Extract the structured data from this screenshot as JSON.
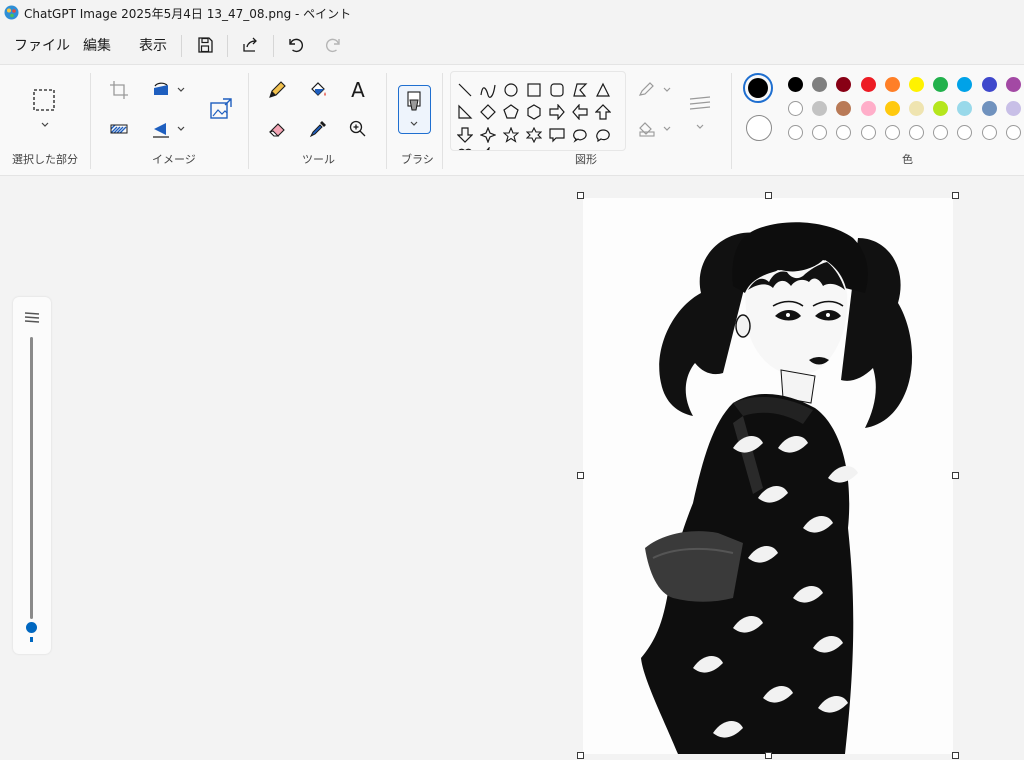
{
  "window": {
    "title": "ChatGPT Image 2025年5月4日 13_47_08.png - ペイント"
  },
  "menu": {
    "file": "ファイル",
    "edit": "編集",
    "view": "表示"
  },
  "ribbon": {
    "selection_label": "選択した部分",
    "image_label": "イメージ",
    "tools_label": "ツール",
    "brush_label": "ブラシ",
    "shapes_label": "図形",
    "colors_label": "色"
  },
  "tools": {
    "text_glyph": "A"
  },
  "palette": {
    "primary": "#000000",
    "secondary": "#ffffff",
    "row1": [
      "#000000",
      "#7f7f7f",
      "#880015",
      "#ed1c24",
      "#ff7f27",
      "#fff200",
      "#22b14c",
      "#00a2e8",
      "#3f48cc",
      "#a349a4"
    ],
    "row2": [
      "#ffffff",
      "#c3c3c3",
      "#b97a57",
      "#ffaec9",
      "#ffc90e",
      "#efe4b0",
      "#b5e61d",
      "#99d9ea",
      "#7092be",
      "#c8bfe7"
    ]
  },
  "zoom": {
    "level_fraction": 0.02
  }
}
